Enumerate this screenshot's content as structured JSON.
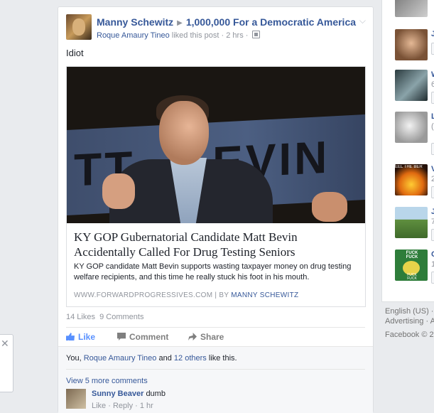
{
  "post": {
    "author": "Manny Schewitz",
    "target_group": "1,000,000 For a Democratic America",
    "liker": "Roque Amaury Tineo",
    "liked_text": "liked this post",
    "time": "· 2 hrs ·",
    "message": "Idiot",
    "link": {
      "title": "KY GOP Gubernatorial Candidate Matt Bevin Accidentally Called For Drug Testing Seniors",
      "description": "KY GOP candidate Matt Bevin supports wasting taxpayer money on drug testing welfare recipients, and this time he really stuck his foot in his mouth.",
      "source_domain": "WWW.FORWARDPROGRESSIVES.COM",
      "source_sep": "|",
      "source_by": "BY",
      "source_author": "MANNY SCHEWITZ",
      "image_banner_left": "TT",
      "image_banner_right": "EVIN"
    },
    "counts": {
      "likes": "14 Likes",
      "comments": "9 Comments"
    },
    "actions": {
      "like": "Like",
      "comment": "Comment",
      "share": "Share"
    },
    "likers_line": {
      "prefix": "You,",
      "name": "Roque Amaury Tineo",
      "and": "and",
      "others": "12 others",
      "suffix": "like this."
    },
    "view_more": "View 5 more comments",
    "comment": {
      "author": "Sunny Beaver",
      "text": "dumb",
      "meta": "Like · Reply · 1 hr"
    }
  },
  "right_column": {
    "items": [
      {
        "initial": "J",
        "sub": ""
      },
      {
        "initial": "W",
        "sub": "6"
      },
      {
        "initial": "L",
        "sub": "("
      },
      {
        "initial": "V",
        "sub": "2"
      },
      {
        "initial": "J",
        "sub": "7"
      },
      {
        "initial": "C",
        "sub": "1"
      }
    ],
    "thumb_labels": [
      "EEL THE BER",
      "FUCK FUCK",
      "FUCK FUCK"
    ]
  },
  "footer": {
    "language": "English (US) ·",
    "advertising": "Advertising · A",
    "copyright": "Facebook © 2"
  },
  "colors": {
    "link": "#365899",
    "like_blue": "#5890ff",
    "page_bg": "#e9ebee"
  }
}
